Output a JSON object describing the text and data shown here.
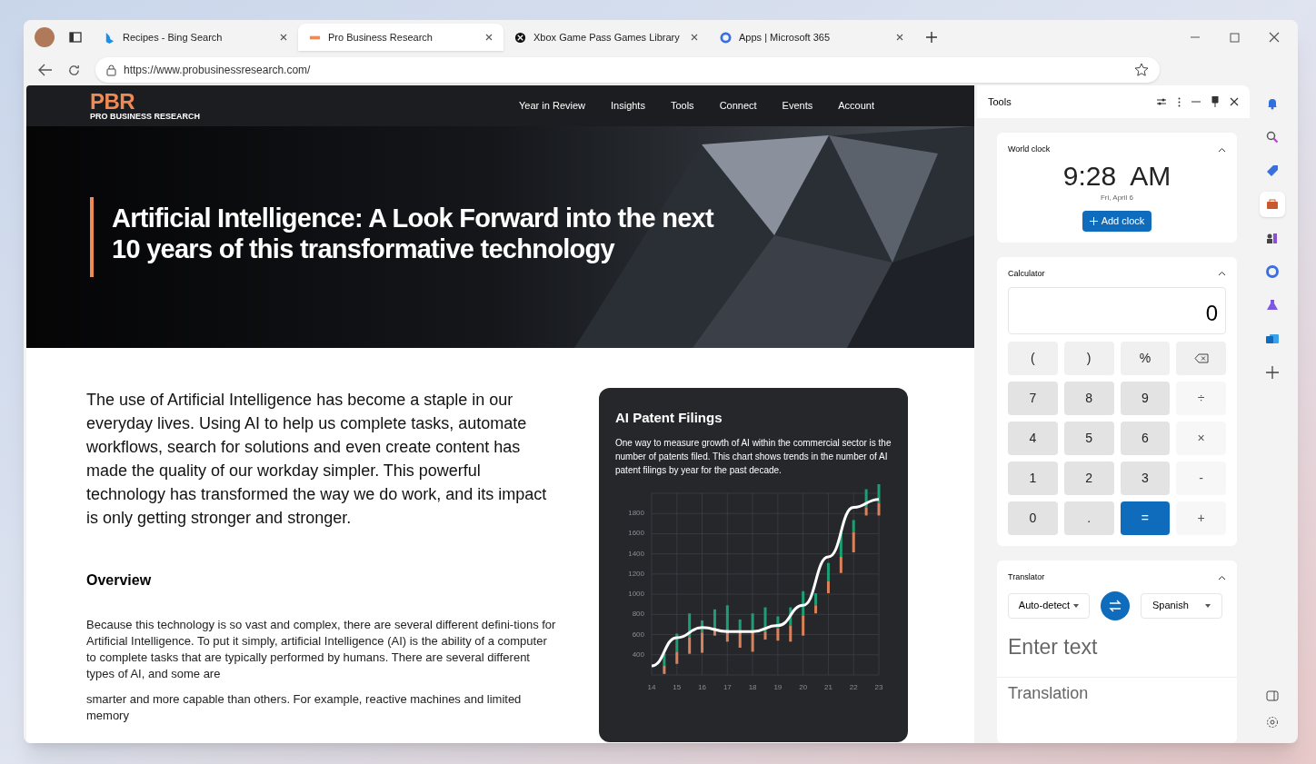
{
  "browser": {
    "tabs": [
      {
        "label": "Recipes - Bing Search",
        "selected": false
      },
      {
        "label": "Pro Business Research",
        "selected": true
      },
      {
        "label": "Xbox Game Pass Games Library",
        "selected": false
      },
      {
        "label": "Apps | Microsoft 365",
        "selected": false
      }
    ],
    "url": "https://www.probusinessresearch.com/"
  },
  "site": {
    "logo": {
      "mark": "PBR",
      "name": "PRO BUSINESS RESEARCH"
    },
    "nav": [
      "Year in Review",
      "Insights",
      "Tools",
      "Connect",
      "Events",
      "Account"
    ],
    "hero_title": "Artificial Intelligence: A Look Forward into the next 10 years of this transformative technology",
    "intro": "The use of Artificial Intelligence has become a staple in our everyday lives. Using AI to help us complete tasks, automate workflows, search for solutions and even create content has made the quality of our workday simpler. This powerful technology has transformed the way we do work, and its impact is only getting stronger and stronger.",
    "overview_heading": "Overview",
    "paragraphs": [
      "Because this technology is so vast and complex, there are several different defini-tions for Artificial Intelligence. To put it simply, artificial Intelligence (AI) is the ability of a computer to complete tasks that are typically performed by humans. There are several different types of AI, and some are",
      "smarter and more capable than others. For example, reactive machines and limited memory"
    ],
    "chart_card": {
      "title": "AI Patent Filings",
      "description": "One way to measure growth of AI within the commercial sector is the number of patents filed. This chart shows trends in the number of AI patent filings by year for the past decade.",
      "chart_data": {
        "type": "line",
        "x": [
          "14",
          "15",
          "16",
          "17",
          "18",
          "19",
          "20",
          "21",
          "22",
          "23"
        ],
        "grid": true,
        "series": [
          {
            "color": "#ffffff",
            "values": [
              290,
              570,
              670,
              630,
              630,
              690,
              890,
              1370,
              1860,
              1940
            ]
          }
        ],
        "ylim": [
          200,
          2000
        ],
        "yticks": [
          400,
          600,
          800,
          1000,
          1200,
          1400,
          1600,
          1800
        ]
      }
    }
  },
  "tools_panel": {
    "title": "Tools",
    "world_clock": {
      "title": "World clock",
      "time": "9:28  AM",
      "date": "Fri, April 6",
      "add_button": "Add clock"
    },
    "calculator": {
      "title": "Calculator",
      "display": "0",
      "keys": [
        {
          "label": "(",
          "kind": "func"
        },
        {
          "label": ")",
          "kind": "func"
        },
        {
          "label": "%",
          "kind": "func"
        },
        {
          "kind": "backspace"
        },
        {
          "label": "7",
          "kind": "digit"
        },
        {
          "label": "8",
          "kind": "digit"
        },
        {
          "label": "9",
          "kind": "digit"
        },
        {
          "label": "÷",
          "kind": "op"
        },
        {
          "label": "4",
          "kind": "digit"
        },
        {
          "label": "5",
          "kind": "digit"
        },
        {
          "label": "6",
          "kind": "digit"
        },
        {
          "label": "×",
          "kind": "op"
        },
        {
          "label": "1",
          "kind": "digit"
        },
        {
          "label": "2",
          "kind": "digit"
        },
        {
          "label": "3",
          "kind": "digit"
        },
        {
          "label": "-",
          "kind": "op"
        },
        {
          "label": "0",
          "kind": "digit"
        },
        {
          "label": ".",
          "kind": "digit"
        },
        {
          "label": "=",
          "kind": "equals"
        },
        {
          "label": "+",
          "kind": "op"
        }
      ]
    },
    "translator": {
      "title": "Translator",
      "source": "Auto-detect",
      "target": "Spanish",
      "placeholder": "Enter text",
      "output_placeholder": "Translation"
    }
  },
  "sidebar_apps": [
    {
      "kind": "bell",
      "selected": false
    },
    {
      "kind": "search",
      "selected": false
    },
    {
      "kind": "tag",
      "selected": false
    },
    {
      "kind": "toolbox",
      "selected": true
    },
    {
      "kind": "chess",
      "selected": false
    },
    {
      "kind": "office",
      "selected": false
    },
    {
      "kind": "flask",
      "selected": false
    },
    {
      "kind": "mail",
      "selected": false
    }
  ]
}
